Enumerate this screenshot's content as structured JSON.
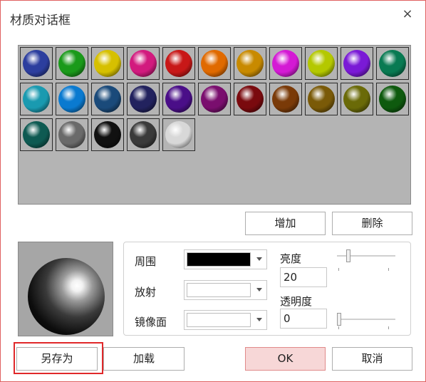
{
  "window": {
    "title": "材质对话框",
    "close_icon": "×"
  },
  "materials": {
    "swatches": [
      {
        "name": "blue-sphere",
        "color": "#2c3e9e"
      },
      {
        "name": "green-sphere",
        "color": "#1a9a1a"
      },
      {
        "name": "yellow-sphere",
        "color": "#d6c000"
      },
      {
        "name": "pink-sphere",
        "color": "#d21a7e"
      },
      {
        "name": "red-sphere",
        "color": "#c81818"
      },
      {
        "name": "orange-sphere",
        "color": "#e06a00"
      },
      {
        "name": "gold-sphere",
        "color": "#c88a00"
      },
      {
        "name": "magenta-sphere",
        "color": "#d41ad4"
      },
      {
        "name": "lime-sphere",
        "color": "#b4c800"
      },
      {
        "name": "purple-sphere",
        "color": "#7a1ad6"
      },
      {
        "name": "teal-green-sphere",
        "color": "#087a52"
      },
      {
        "name": "cyan-sphere",
        "color": "#1a9ab0"
      },
      {
        "name": "sky-blue-sphere",
        "color": "#0a7ad0"
      },
      {
        "name": "steel-blue-sphere",
        "color": "#1a4a7a"
      },
      {
        "name": "navy-sphere",
        "color": "#22225e"
      },
      {
        "name": "violet-sphere",
        "color": "#4a0e88"
      },
      {
        "name": "plum-sphere",
        "color": "#7a0e6e"
      },
      {
        "name": "maroon-sphere",
        "color": "#7a0a0e"
      },
      {
        "name": "brown-sphere",
        "color": "#7a3a08"
      },
      {
        "name": "olive-brown-sphere",
        "color": "#7a5a08"
      },
      {
        "name": "olive-sphere",
        "color": "#6a6a08"
      },
      {
        "name": "dark-green-sphere",
        "color": "#0e5a0e"
      },
      {
        "name": "dark-teal-sphere",
        "color": "#0e5a52"
      },
      {
        "name": "gray-sphere",
        "color": "#6a6a6a"
      },
      {
        "name": "black-sphere",
        "color": "#111111"
      },
      {
        "name": "charcoal-sphere",
        "color": "#3a3a3a"
      },
      {
        "name": "white-sphere",
        "color": "#d8d8d8"
      }
    ]
  },
  "buttons": {
    "add": "增加",
    "delete": "删除",
    "save_as": "另存为",
    "load": "加载",
    "ok": "OK",
    "cancel": "取消"
  },
  "props": {
    "ambient_label": "周围",
    "ambient_color": "#000000",
    "emissive_label": "放射",
    "emissive_color": "#ffffff",
    "specular_label": "镜像面",
    "specular_color": "#ffffff",
    "brightness_label": "亮度",
    "brightness_value": "20",
    "brightness_level": 0.2,
    "opacity_label": "透明度",
    "opacity_value": "0",
    "opacity_level": 0.0
  }
}
